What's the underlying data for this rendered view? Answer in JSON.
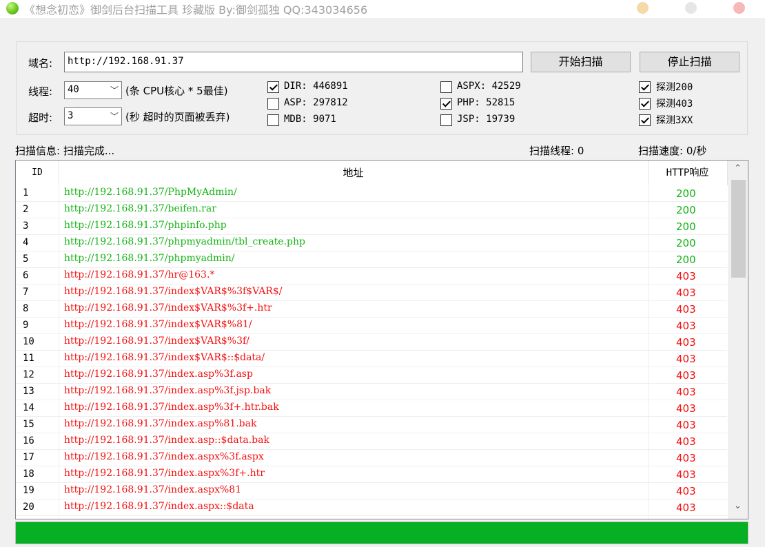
{
  "window": {
    "title": "《想念初恋》御剑后台扫描工具 珍藏版 By:御剑孤独 QQ:343034656",
    "icon": "green-orb-icon"
  },
  "form": {
    "domain_label": "域名:",
    "domain_value": "http://192.168.91.37",
    "start_button": "开始扫描",
    "stop_button": "停止扫描",
    "threads_label": "线程:",
    "threads_value": "40",
    "threads_hint": "(条 CPU核心 * 5最佳)",
    "timeout_label": "超时:",
    "timeout_value": "3",
    "timeout_hint": "(秒 超时的页面被丢弃)"
  },
  "dictionaries": [
    {
      "label": "DIR: 446891",
      "checked": true
    },
    {
      "label": "ASP: 297812",
      "checked": false
    },
    {
      "label": "MDB: 9071",
      "checked": false
    },
    {
      "label": "ASPX: 42529",
      "checked": false
    },
    {
      "label": "PHP: 52815",
      "checked": true
    },
    {
      "label": "JSP: 19739",
      "checked": false
    }
  ],
  "probes": [
    {
      "label": "探测200",
      "checked": true
    },
    {
      "label": "探测403",
      "checked": true
    },
    {
      "label": "探测3XX",
      "checked": true
    }
  ],
  "status": {
    "info": "扫描信息: 扫描完成...",
    "threads": "扫描线程: 0",
    "speed": "扫描速度: 0/秒"
  },
  "table": {
    "headers": [
      "ID",
      "地址",
      "HTTP响应"
    ],
    "rows": [
      {
        "id": "1",
        "url": "http://192.168.91.37/PhpMyAdmin/",
        "code": "200"
      },
      {
        "id": "2",
        "url": "http://192.168.91.37/beifen.rar",
        "code": "200"
      },
      {
        "id": "3",
        "url": "http://192.168.91.37/phpinfo.php",
        "code": "200"
      },
      {
        "id": "4",
        "url": "http://192.168.91.37/phpmyadmin/tbl_create.php",
        "code": "200"
      },
      {
        "id": "5",
        "url": "http://192.168.91.37/phpmyadmin/",
        "code": "200"
      },
      {
        "id": "6",
        "url": "http://192.168.91.37/hr@163.*",
        "code": "403"
      },
      {
        "id": "7",
        "url": "http://192.168.91.37/index$VAR$%3f$VAR$/",
        "code": "403"
      },
      {
        "id": "8",
        "url": "http://192.168.91.37/index$VAR$%3f+.htr",
        "code": "403"
      },
      {
        "id": "9",
        "url": "http://192.168.91.37/index$VAR$%81/",
        "code": "403"
      },
      {
        "id": "10",
        "url": "http://192.168.91.37/index$VAR$%3f/",
        "code": "403"
      },
      {
        "id": "11",
        "url": "http://192.168.91.37/index$VAR$::$data/",
        "code": "403"
      },
      {
        "id": "12",
        "url": "http://192.168.91.37/index.asp%3f.asp",
        "code": "403"
      },
      {
        "id": "13",
        "url": "http://192.168.91.37/index.asp%3f.jsp.bak",
        "code": "403"
      },
      {
        "id": "14",
        "url": "http://192.168.91.37/index.asp%3f+.htr.bak",
        "code": "403"
      },
      {
        "id": "15",
        "url": "http://192.168.91.37/index.asp%81.bak",
        "code": "403"
      },
      {
        "id": "16",
        "url": "http://192.168.91.37/index.asp::$data.bak",
        "code": "403"
      },
      {
        "id": "17",
        "url": "http://192.168.91.37/index.aspx%3f.aspx",
        "code": "403"
      },
      {
        "id": "18",
        "url": "http://192.168.91.37/index.aspx%3f+.htr",
        "code": "403"
      },
      {
        "id": "19",
        "url": "http://192.168.91.37/index.aspx%81",
        "code": "403"
      },
      {
        "id": "20",
        "url": "http://192.168.91.37/index.aspx::$data",
        "code": "403"
      }
    ]
  },
  "scrollbar": {
    "up": "⌃",
    "down": "⌄"
  },
  "progress": {
    "value": 1.0,
    "color": "#06b025"
  },
  "colors": {
    "ok": "#16b516",
    "forbidden": "#f41010"
  }
}
